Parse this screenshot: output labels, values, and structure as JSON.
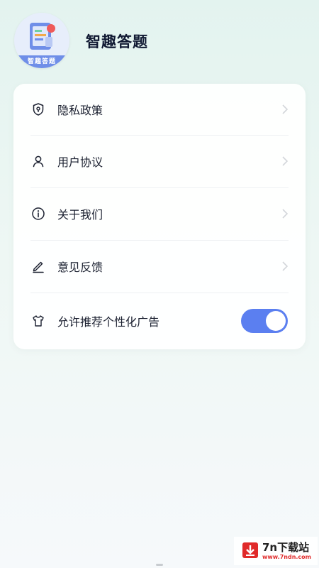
{
  "app": {
    "title": "智趣答题",
    "icon_ribbon": "智趣答题"
  },
  "menu": [
    {
      "label": "隐私政策",
      "icon": "shield-icon"
    },
    {
      "label": "用户协议",
      "icon": "user-icon"
    },
    {
      "label": "关于我们",
      "icon": "info-icon"
    },
    {
      "label": "意见反馈",
      "icon": "pencil-icon"
    }
  ],
  "personalized_ads": {
    "label": "允许推荐个性化广告",
    "icon": "shirt-icon",
    "enabled": true
  },
  "watermark": {
    "title": "7n下载站",
    "url": "www.7ndn.com"
  },
  "colors": {
    "toggle_on": "#5b7ff0",
    "background_top": "#e3f3ef"
  }
}
